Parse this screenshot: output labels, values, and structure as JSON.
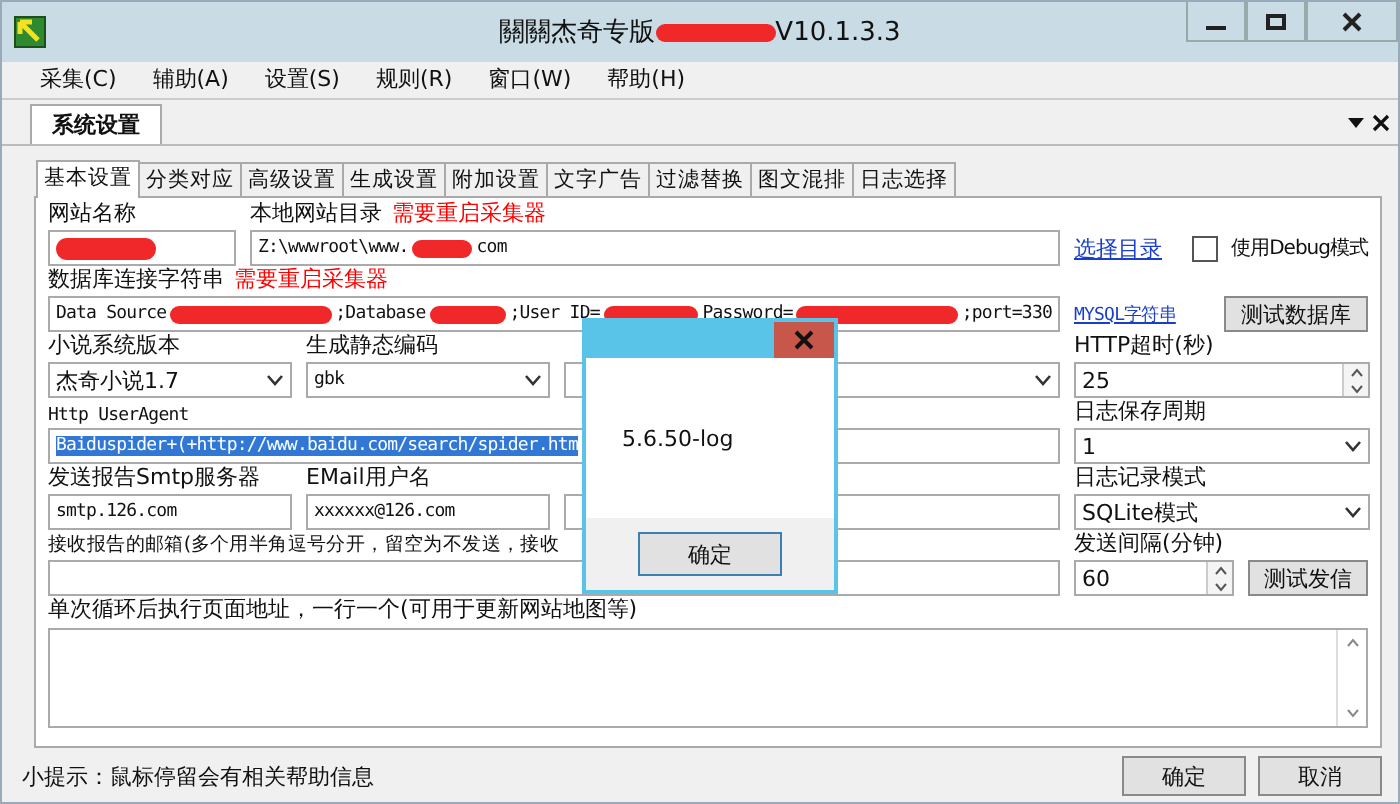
{
  "window": {
    "title_parts": [
      "關關杰奇专版",
      "V10.1.3.3"
    ]
  },
  "menu": [
    "采集(C)",
    "辅助(A)",
    "设置(S)",
    "规则(R)",
    "窗口(W)",
    "帮助(H)"
  ],
  "doc_tabs": [
    {
      "label": "系统设置",
      "selected": true
    }
  ],
  "tabs": [
    {
      "label": "基本设置",
      "selected": true
    },
    {
      "label": "分类对应",
      "selected": false
    },
    {
      "label": "高级设置",
      "selected": false
    },
    {
      "label": "生成设置",
      "selected": false
    },
    {
      "label": "附加设置",
      "selected": false
    },
    {
      "label": "文字广告",
      "selected": false
    },
    {
      "label": "过滤替换",
      "selected": false
    },
    {
      "label": "图文混排",
      "selected": false
    },
    {
      "label": "日志选择",
      "selected": false
    }
  ],
  "form": {
    "site_name": {
      "label": "网站名称"
    },
    "local_dir": {
      "label": "本地网站目录",
      "note": "需要重启采集器",
      "value_parts": [
        "Z:\\wwwroot\\www.",
        "com"
      ]
    },
    "browse_link": "选择目录",
    "debug": {
      "label": "使用Debug模式",
      "checked": false
    },
    "db": {
      "label": "数据库连接字符串",
      "note": "需要重启采集器",
      "value_parts": [
        "Data Source",
        ";Database",
        ";User ID=",
        "Password=",
        ";port=330"
      ]
    },
    "mysql_link": "MYSQL字符串",
    "test_db_button": "测试数据库",
    "novel_version": {
      "label": "小说系统版本",
      "value": "杰奇小说1.7"
    },
    "encoding": {
      "label": "生成静态编码",
      "value": "gbk"
    },
    "http_timeout": {
      "label": "HTTP超时(秒)",
      "value": "25"
    },
    "user_agent": {
      "label": "Http UserAgent",
      "value": "Baiduspider+(+http://www.baidu.com/search/spider.htm",
      "selected": true
    },
    "log_period": {
      "label": "日志保存周期",
      "value": "1"
    },
    "smtp": {
      "label": "发送报告Smtp服务器",
      "value": "smtp.126.com"
    },
    "email_user": {
      "label": "EMail用户名",
      "value": "xxxxxx@126.com"
    },
    "log_mode": {
      "label": "日志记录模式",
      "value": "SQLite模式"
    },
    "receive": {
      "label": "接收报告的邮箱(多个用半角逗号分开，留空为不发送，接收"
    },
    "interval": {
      "label": "发送间隔(分钟)",
      "value": "60"
    },
    "test_mail_button": "测试发信",
    "after_loop": {
      "label": "单次循环后执行页面地址，一行一个(可用于更新网站地图等)"
    }
  },
  "hint": "小提示：鼠标停留会有相关帮助信息",
  "buttons": [
    "确定",
    "取消"
  ],
  "dialog": {
    "message": "5.6.50-log",
    "button": "确定"
  }
}
